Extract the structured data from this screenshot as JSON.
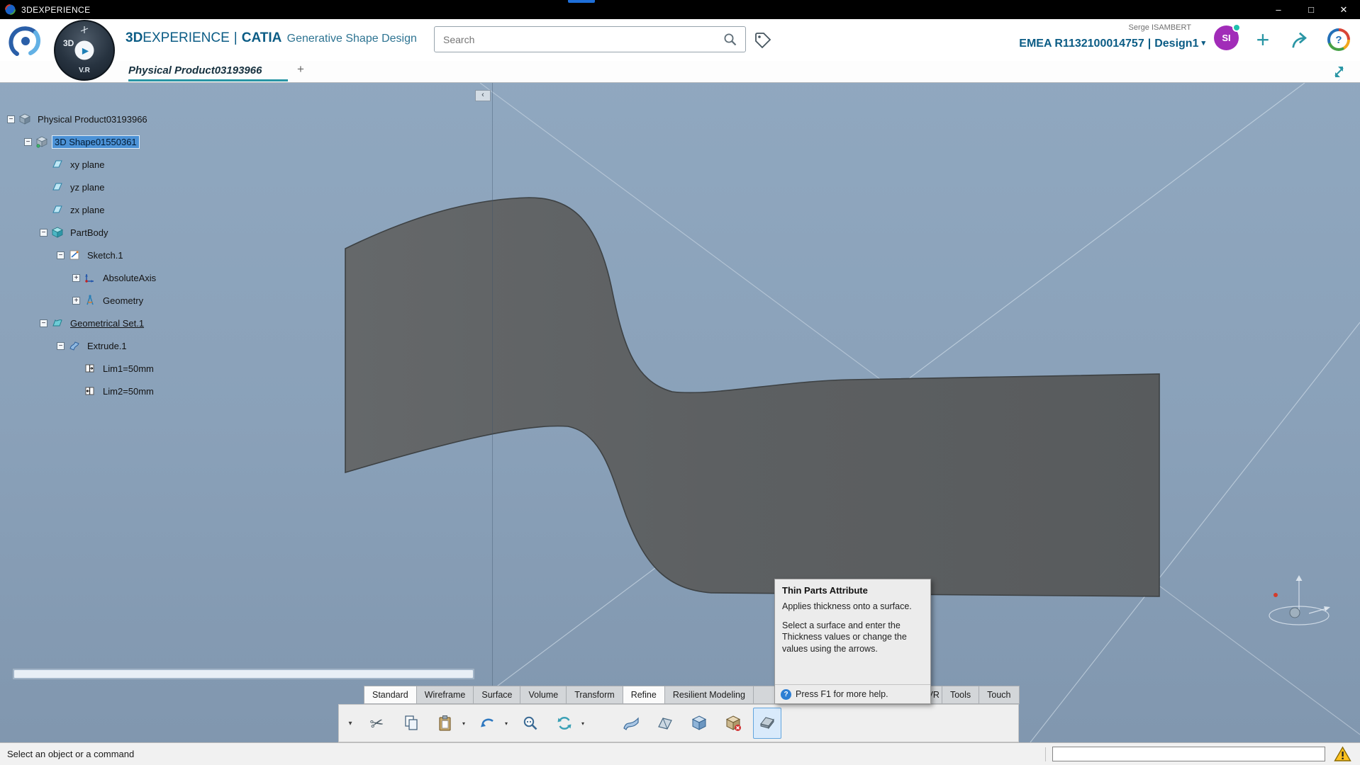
{
  "colors": {
    "accent_teal": "#2a96a5",
    "brand_blue": "#0b5c85",
    "selection_blue": "#4c92d6",
    "viewport_bg": "#8aa1b9",
    "warning_orange": "#ffc21e"
  },
  "titlebar": {
    "app_name": "3DEXPERIENCE",
    "minimize": "–",
    "maximize": "□",
    "close": "✕"
  },
  "header": {
    "brand_bold": "3D",
    "brand_rest": "EXPERIENCE",
    "brand_sep": "|",
    "brand_app": "CATIA",
    "brand_module": "Generative Shape Design",
    "search_placeholder": "Search",
    "user_name": "Serge ISAMBERT",
    "tenant": "EMEA R1132100014757",
    "tenant_sep": "|",
    "workspace": "Design1",
    "workspace_caret": "▾",
    "avatar_initials": "SI",
    "add_label": "+",
    "compass_top": "3D",
    "compass_play": "▶",
    "compass_bottom": "V.R"
  },
  "tabbar": {
    "document_tab": "Physical Product03193966",
    "add_tab": "+"
  },
  "viewport": {
    "panel_collapse": "‹"
  },
  "tree": {
    "items": [
      {
        "label": "Physical Product03193966",
        "expander": "−"
      },
      {
        "label": "3D Shape01550361",
        "expander": "−",
        "selected": true
      },
      {
        "label": "xy plane"
      },
      {
        "label": "yz plane"
      },
      {
        "label": "zx plane"
      },
      {
        "label": "PartBody",
        "expander": "−"
      },
      {
        "label": "Sketch.1",
        "expander": "−"
      },
      {
        "label": "AbsoluteAxis",
        "expander": "+"
      },
      {
        "label": "Geometry",
        "expander": "+"
      },
      {
        "label": "Geometrical Set.1",
        "expander": "−",
        "underlined": true
      },
      {
        "label": "Extrude.1",
        "expander": "−"
      },
      {
        "label": "Lim1=50mm"
      },
      {
        "label": "Lim2=50mm"
      }
    ]
  },
  "tooltip": {
    "title": "Thin Parts Attribute",
    "body1": "Applies thickness onto a surface.",
    "body2": "Select a surface and enter the Thickness values or change the values using the arrows.",
    "footer_icon": "?",
    "footer": "Press F1 for more help."
  },
  "ribbon": {
    "tabs": [
      {
        "label": "Standard",
        "active": true
      },
      {
        "label": "Wireframe",
        "active": false
      },
      {
        "label": "Surface",
        "active": false
      },
      {
        "label": "Volume",
        "active": false
      },
      {
        "label": "Transform",
        "active": false
      },
      {
        "label": "Refine",
        "active": true
      },
      {
        "label": "Resilient Modeling",
        "active": false
      },
      {
        "label": "AR-VR",
        "active": false
      },
      {
        "label": "Tools",
        "active": false
      },
      {
        "label": "Touch",
        "active": false
      }
    ]
  },
  "toolbar": {
    "overflow_caret": "▾",
    "dropdown_caret": "▾",
    "cut_glyph": "✂",
    "icons": [
      "cut-icon",
      "copy-icon",
      "paste-icon",
      "undo-icon",
      "zoom-area-icon",
      "update-icon",
      "sweep-surface-icon",
      "blend-surface-icon",
      "volume-cube-icon",
      "volume-cube-delete-icon",
      "thin-parts-icon"
    ]
  },
  "statusbar": {
    "message": "Select an object or a command"
  }
}
